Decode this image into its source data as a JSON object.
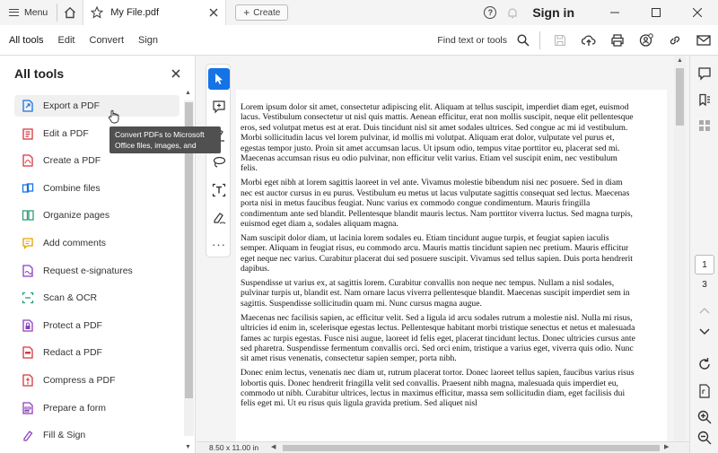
{
  "titlebar": {
    "menu_label": "Menu",
    "doc_tab_title": "My File.pdf",
    "create_label": "Create",
    "signin_label": "Sign in"
  },
  "toolbar": {
    "tabs": [
      "All tools",
      "Edit",
      "Convert",
      "Sign"
    ],
    "find_label": "Find text or tools"
  },
  "left_panel": {
    "title": "All tools",
    "tools": [
      {
        "label": "Export a PDF",
        "icon": "export-pdf-icon",
        "color": "#1473e6"
      },
      {
        "label": "Edit a PDF",
        "icon": "edit-pdf-icon",
        "color": "#d7373f"
      },
      {
        "label": "Create a PDF",
        "icon": "create-pdf-icon",
        "color": "#d7373f"
      },
      {
        "label": "Combine files",
        "icon": "combine-files-icon",
        "color": "#1473e6"
      },
      {
        "label": "Organize pages",
        "icon": "organize-pages-icon",
        "color": "#2d9d78"
      },
      {
        "label": "Add comments",
        "icon": "add-comments-icon",
        "color": "#e8a200"
      },
      {
        "label": "Request e-signatures",
        "icon": "request-esignatures-icon",
        "color": "#8a3fbd"
      },
      {
        "label": "Scan & OCR",
        "icon": "scan-ocr-icon",
        "color": "#2d9d78"
      },
      {
        "label": "Protect a PDF",
        "icon": "protect-pdf-icon",
        "color": "#8a3fbd"
      },
      {
        "label": "Redact a PDF",
        "icon": "redact-pdf-icon",
        "color": "#d7373f"
      },
      {
        "label": "Compress a PDF",
        "icon": "compress-pdf-icon",
        "color": "#d7373f"
      },
      {
        "label": "Prepare a form",
        "icon": "prepare-form-icon",
        "color": "#8a3fbd"
      },
      {
        "label": "Fill & Sign",
        "icon": "fill-sign-icon",
        "color": "#8a3fbd"
      }
    ]
  },
  "tooltip": {
    "line1": "Convert PDFs to Microsoft",
    "line2": "Office files, images, and more"
  },
  "document": {
    "page_size": "8.50 x 11.00 in",
    "paragraphs": [
      "Lorem ipsum dolor sit amet, consectetur adipiscing elit. Aliquam at tellus suscipit, imperdiet diam eget, euismod lacus. Vestibulum consectetur ut nisl quis mattis. Aenean efficitur, erat non mollis suscipit, neque elit pellentesque eros, sed volutpat metus est at erat. Duis tincidunt nisl sit amet sodales ultrices. Sed congue ac mi id vestibulum. Morbi sollicitudin lacus vel lorem pulvinar, id mollis mi volutpat. Aliquam erat dolor, vulputate vel purus et, egestas tempor justo. Proin sit amet accumsan lacus. Ut ipsum odio, tempus vitae porttitor eu, placerat sed mi. Maecenas accumsan risus eu odio pulvinar, non efficitur velit varius. Etiam vel suscipit enim, nec vestibulum felis.",
      "Morbi eget nibh at lorem sagittis laoreet in vel ante. Vivamus molestie bibendum nisi nec posuere. Sed in diam nec est auctor cursus in eu purus. Vestibulum eu metus ut lacus vulputate sagittis consequat sed lectus. Maecenas porta nisi in metus faucibus feugiat. Nunc varius ex commodo congue condimentum. Mauris fringilla condimentum ante sed blandit. Pellentesque blandit mauris lectus. Nam porttitor viverra luctus. Sed magna turpis, euismod eget diam a, sodales aliquam magna.",
      "Nam suscipit dolor diam, ut lacinia lorem sodales eu. Etiam tincidunt augue turpis, et feugiat sapien iaculis semper. Aliquam in feugiat risus, eu commodo arcu. Mauris mattis tincidunt sapien nec pretium. Mauris efficitur eget neque nec varius. Curabitur placerat dui sed posuere suscipit. Vivamus sed tellus sapien. Duis porta hendrerit dapibus.",
      "Suspendisse ut varius ex, at sagittis lorem. Curabitur convallis non neque nec tempus. Nullam a nisl sodales, pulvinar turpis ut, blandit est. Nam ornare lacus viverra pellentesque blandit. Maecenas suscipit imperdiet sem in sagittis. Suspendisse sollicitudin quam mi. Nunc cursus magna augue.",
      "Maecenas nec facilisis sapien, ac efficitur velit. Sed a ligula id arcu sodales rutrum a molestie nisl. Nulla mi risus, ultricies id enim in, scelerisque egestas lectus. Pellentesque habitant morbi tristique senectus et netus et malesuada fames ac turpis egestas. Fusce nisi augue, laoreet id felis eget, placerat tincidunt lectus. Donec ultricies cursus ante sed pharetra. Suspendisse fermentum convallis orci. Sed orci enim, tristique a varius eget, viverra quis odio. Nunc sit amet risus venenatis, consectetur sapien semper, porta nibh.",
      "Donec enim lectus, venenatis nec diam ut, rutrum placerat tortor. Donec laoreet tellus sapien, faucibus varius risus lobortis quis. Donec hendrerit fringilla velit sed convallis. Praesent nibh magna, malesuada quis imperdiet eu, commodo ut nibh. Curabitur ultrices, lectus in maximus efficitur, massa sem sollicitudin diam, eget facilisis dui felis eget mi. Ut eu risus quis ligula gravida pretium. Sed aliquet nisl"
    ]
  },
  "right_rail": {
    "current_page": "1",
    "total_pages": "3"
  },
  "colors": {
    "accent": "#1473e6"
  }
}
